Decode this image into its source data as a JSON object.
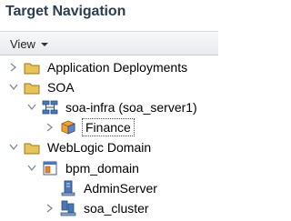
{
  "panel": {
    "title": "Target Navigation"
  },
  "toolbar": {
    "view_label": "View"
  },
  "tree": {
    "application_deployments": {
      "label": "Application Deployments",
      "expanded": false
    },
    "soa": {
      "label": "SOA",
      "expanded": true
    },
    "soa_infra": {
      "label": "soa-infra (soa_server1)",
      "expanded": true
    },
    "finance": {
      "label": "Finance",
      "expanded": false,
      "selected": true
    },
    "weblogic_domain": {
      "label": "WebLogic Domain",
      "expanded": true
    },
    "bpm_domain": {
      "label": "bpm_domain",
      "expanded": true
    },
    "adminserver": {
      "label": "AdminServer"
    },
    "soa_cluster": {
      "label": "soa_cluster",
      "expanded": false
    }
  },
  "colors": {
    "title": "#2c3e50",
    "folder": "#e8c35a",
    "disclosure": "#7a8a99"
  }
}
